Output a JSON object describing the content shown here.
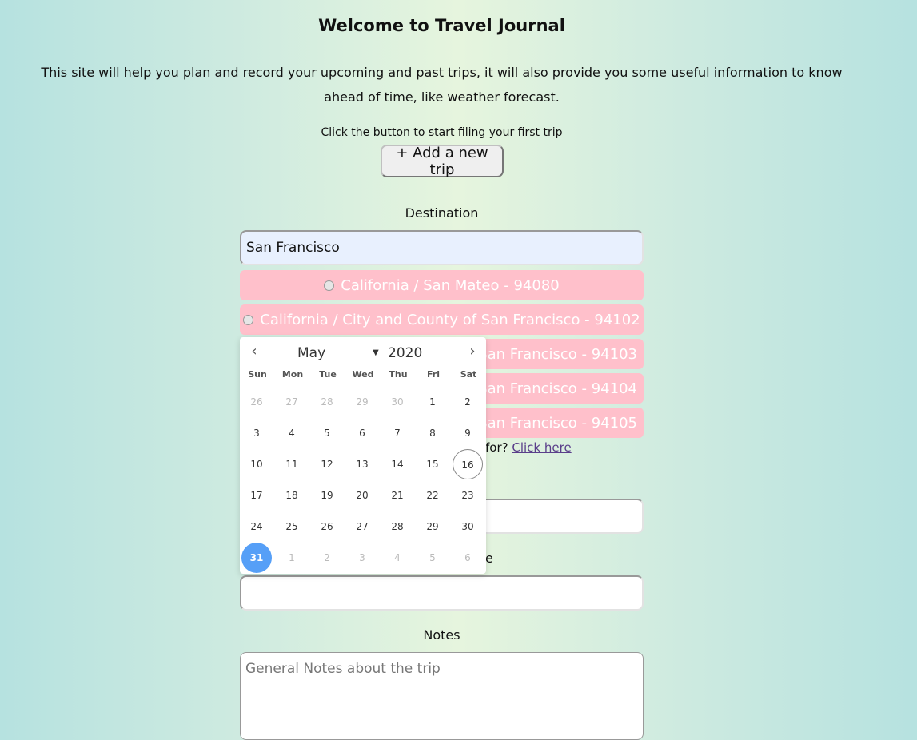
{
  "header": {
    "title": "Welcome to Travel Journal",
    "intro": "This site will help you plan and record your upcoming and past trips, it will also provide you some useful information to know ahead of time, like weather forecast.",
    "cta_text": "Click the button to start filing your first trip",
    "add_button": "+ Add a new trip"
  },
  "form": {
    "destination_label": "Destination",
    "destination_value": "San Francisco",
    "options": [
      "California / San Mateo - 94080",
      "California / City and County of San Francisco - 94102",
      "California / City and County of San Francisco - 94103",
      "California / City and County of San Francisco - 94104",
      "California / City and County of San Francisco - 94105"
    ],
    "option_tail": [
      "San Francisco - 94103",
      "San Francisco - 94104",
      "San Francisco - 94105"
    ],
    "hint_fragment": "for?",
    "hint_link": "Click here",
    "end_date_fragment": "e",
    "notes_label": "Notes",
    "notes_placeholder": "General Notes about the trip"
  },
  "datepicker": {
    "month": "May",
    "year": "2020",
    "weekdays": [
      "Sun",
      "Mon",
      "Tue",
      "Wed",
      "Thu",
      "Fri",
      "Sat"
    ],
    "weeks": [
      [
        "26",
        "27",
        "28",
        "29",
        "30",
        "1",
        "2"
      ],
      [
        "3",
        "4",
        "5",
        "6",
        "7",
        "8",
        "9"
      ],
      [
        "10",
        "11",
        "12",
        "13",
        "14",
        "15",
        "16"
      ],
      [
        "17",
        "18",
        "19",
        "20",
        "21",
        "22",
        "23"
      ],
      [
        "24",
        "25",
        "26",
        "27",
        "28",
        "29",
        "30"
      ],
      [
        "31",
        "1",
        "2",
        "3",
        "4",
        "5",
        "6"
      ]
    ],
    "today": "16",
    "selected": "31",
    "colors": {
      "selected": "#569ff7",
      "option_bg": "#ffc0cb"
    }
  }
}
